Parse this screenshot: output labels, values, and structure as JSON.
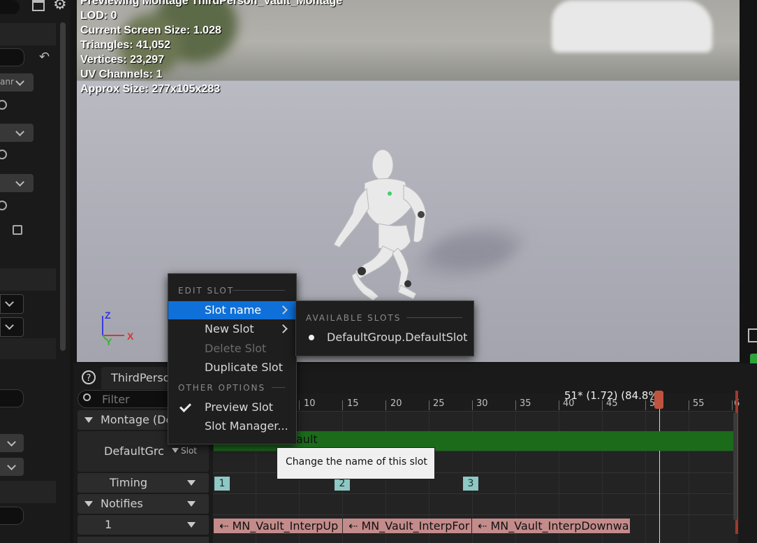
{
  "viewport": {
    "stats": [
      "Previewing Montage ThirdPerson_Vault_Montage",
      "LOD: 0",
      "Current Screen Size: 1.028",
      "Triangles: 41,052",
      "Vertices: 23,297",
      "UV Channels: 1",
      "Approx Size: 277x105x283"
    ],
    "gizmo": {
      "z": "Z",
      "y": "Y",
      "x": "X"
    }
  },
  "left_panel": {
    "dropdown1": "anr"
  },
  "montage_editor": {
    "tab_label": "ThirdPerson",
    "filter_placeholder": "Filter",
    "rows": {
      "montage": "Montage (De",
      "slot_group": "DefaultGrc",
      "slot_btn": "Slot",
      "timing": "Timing",
      "notifies": "Notifies",
      "notify_track": "1"
    },
    "playhead": "51* (1.72) (84.8%)",
    "ruler_ticks": [
      "10",
      "15",
      "20",
      "25",
      "30",
      "35",
      "40",
      "45",
      "50",
      "55",
      "6"
    ],
    "slot_track_label": "ault",
    "sections": [
      "1",
      "2",
      "3"
    ],
    "notify_states": [
      "MN_Vault_InterpUp",
      "MN_Vault_InterpFor",
      "MN_Vault_InterpDownwa"
    ]
  },
  "context_menu": {
    "edit_slot_header": "EDIT SLOT",
    "items": {
      "slot_name": "Slot name",
      "new_slot": "New Slot",
      "delete_slot": "Delete Slot",
      "duplicate_slot": "Duplicate Slot"
    },
    "other_options_header": "OTHER OPTIONS",
    "other_items": {
      "preview_slot": "Preview Slot",
      "slot_manager": "Slot Manager..."
    }
  },
  "submenu": {
    "header": "AVAILABLE SLOTS",
    "slot": "DefaultGroup.DefaultSlot"
  },
  "tooltip": "Change the name of this slot",
  "colors": {
    "highlight": "#0f70d9",
    "slot_track": "#1b6b1b",
    "section_marker": "#8ec7c3",
    "notify_state": "#c48b8b"
  }
}
